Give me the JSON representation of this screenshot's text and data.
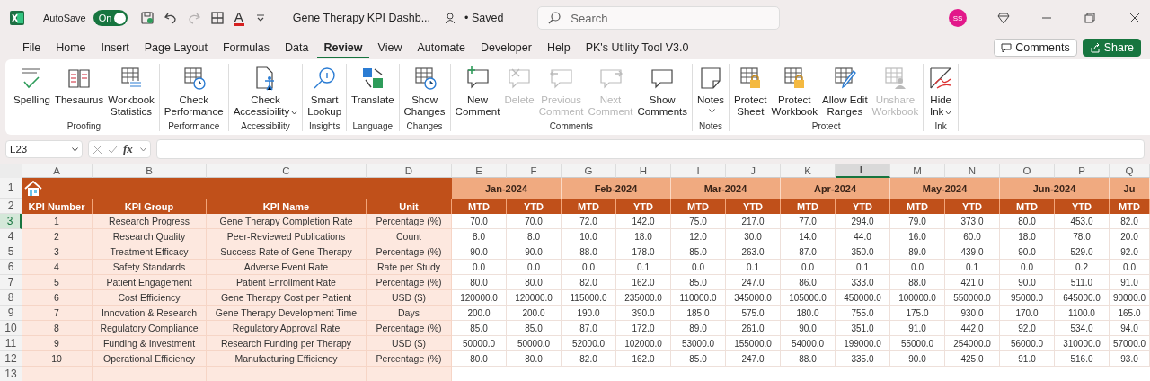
{
  "title_bar": {
    "autosave_label": "AutoSave",
    "autosave": {
      "label": "On",
      "on": true
    },
    "quick_access": [
      {
        "kind": "save",
        "disabled": false
      },
      {
        "kind": "undo",
        "disabled": false
      },
      {
        "kind": "redo",
        "disabled": true
      },
      {
        "kind": "borders",
        "disabled": false
      },
      {
        "kind": "font-color",
        "glyph": "A",
        "disabled": false
      },
      {
        "kind": "customize",
        "disabled": false
      }
    ],
    "document_title": "Gene Therapy KPI Dashb...",
    "save_status": "• Saved",
    "search_placeholder": "Search",
    "avatar_initials": "SS"
  },
  "menu_tabs": [
    {
      "label": "File",
      "selected": false
    },
    {
      "label": "Home",
      "selected": false
    },
    {
      "label": "Insert",
      "selected": false
    },
    {
      "label": "Page Layout",
      "selected": false
    },
    {
      "label": "Formulas",
      "selected": false
    },
    {
      "label": "Data",
      "selected": false
    },
    {
      "label": "Review",
      "selected": true
    },
    {
      "label": "View",
      "selected": false
    },
    {
      "label": "Automate",
      "selected": false
    },
    {
      "label": "Developer",
      "selected": false
    },
    {
      "label": "Help",
      "selected": false
    },
    {
      "label": "PK's Utility Tool V3.0",
      "selected": false
    }
  ],
  "header_buttons": [
    {
      "label": "Comments",
      "kind": "outline"
    },
    {
      "label": "Share",
      "kind": "primary"
    }
  ],
  "ribbon_groups": [
    {
      "label": "Proofing",
      "commands": [
        {
          "lines": [
            "Spelling"
          ],
          "kind": "spelling",
          "disabled": false,
          "dropdown": false
        },
        {
          "lines": [
            "Thesaurus"
          ],
          "kind": "thesaurus",
          "disabled": false,
          "dropdown": false
        },
        {
          "lines": [
            "Workbook",
            "Statistics"
          ],
          "kind": "statistics",
          "disabled": false,
          "dropdown": false
        }
      ]
    },
    {
      "label": "Performance",
      "commands": [
        {
          "lines": [
            "Check",
            "Performance"
          ],
          "kind": "performance",
          "disabled": false,
          "dropdown": false
        }
      ]
    },
    {
      "label": "Accessibility",
      "commands": [
        {
          "lines": [
            "Check",
            "Accessibility"
          ],
          "kind": "accessibility",
          "disabled": false,
          "dropdown": true
        }
      ]
    },
    {
      "label": "Insights",
      "commands": [
        {
          "lines": [
            "Smart",
            "Lookup"
          ],
          "kind": "lookup",
          "disabled": false,
          "dropdown": false
        }
      ]
    },
    {
      "label": "Language",
      "commands": [
        {
          "lines": [
            "Translate"
          ],
          "kind": "translate",
          "disabled": false,
          "dropdown": false
        }
      ]
    },
    {
      "label": "Changes",
      "commands": [
        {
          "lines": [
            "Show",
            "Changes"
          ],
          "kind": "changes",
          "disabled": false,
          "dropdown": false
        }
      ]
    },
    {
      "label": "Comments",
      "commands": [
        {
          "lines": [
            "New",
            "Comment"
          ],
          "kind": "new-comment",
          "disabled": false,
          "dropdown": false
        },
        {
          "lines": [
            "Delete"
          ],
          "kind": "delete-comment",
          "disabled": true,
          "dropdown": false
        },
        {
          "lines": [
            "Previous",
            "Comment"
          ],
          "kind": "previous-comment",
          "disabled": true,
          "dropdown": false
        },
        {
          "lines": [
            "Next",
            "Comment"
          ],
          "kind": "next-comment",
          "disabled": true,
          "dropdown": false
        },
        {
          "lines": [
            "Show",
            "Comments"
          ],
          "kind": "show-comments",
          "disabled": false,
          "dropdown": false
        }
      ]
    },
    {
      "label": "Notes",
      "commands": [
        {
          "lines": [
            "Notes"
          ],
          "kind": "notes",
          "disabled": false,
          "dropdown": true
        }
      ]
    },
    {
      "label": "Protect",
      "commands": [
        {
          "lines": [
            "Protect",
            "Sheet"
          ],
          "kind": "protect",
          "disabled": false,
          "dropdown": false
        },
        {
          "lines": [
            "Protect",
            "Workbook"
          ],
          "kind": "protect",
          "disabled": false,
          "dropdown": false
        },
        {
          "lines": [
            "Allow Edit",
            "Ranges"
          ],
          "kind": "allow-edit",
          "disabled": false,
          "dropdown": false
        },
        {
          "lines": [
            "Unshare",
            "Workbook"
          ],
          "kind": "unshare",
          "disabled": true,
          "dropdown": false
        }
      ]
    },
    {
      "label": "Ink",
      "commands": [
        {
          "lines": [
            "Hide",
            "Ink"
          ],
          "kind": "ink",
          "disabled": false,
          "dropdown": true
        }
      ]
    }
  ],
  "formula_bar": {
    "name_box": "L23",
    "function_label": "fx"
  },
  "columns": [
    {
      "letter": "A",
      "selected": false
    },
    {
      "letter": "B",
      "selected": false
    },
    {
      "letter": "C",
      "selected": false
    },
    {
      "letter": "D",
      "selected": false
    },
    {
      "letter": "E",
      "selected": false
    },
    {
      "letter": "F",
      "selected": false
    },
    {
      "letter": "G",
      "selected": false
    },
    {
      "letter": "H",
      "selected": false
    },
    {
      "letter": "I",
      "selected": false
    },
    {
      "letter": "J",
      "selected": false
    },
    {
      "letter": "K",
      "selected": false
    },
    {
      "letter": "L",
      "selected": true
    },
    {
      "letter": "M",
      "selected": false
    },
    {
      "letter": "N",
      "selected": false
    },
    {
      "letter": "O",
      "selected": false
    },
    {
      "letter": "P",
      "selected": false
    },
    {
      "letter": "Q",
      "selected": false
    }
  ],
  "row_numbers": [
    {
      "number": "1",
      "selected": false
    },
    {
      "number": "2",
      "selected": false
    },
    {
      "number": "3",
      "selected": true
    },
    {
      "number": "4",
      "selected": false
    },
    {
      "number": "5",
      "selected": false
    },
    {
      "number": "6",
      "selected": false
    },
    {
      "number": "7",
      "selected": false
    },
    {
      "number": "8",
      "selected": false
    },
    {
      "number": "9",
      "selected": false
    },
    {
      "number": "10",
      "selected": false
    },
    {
      "number": "11",
      "selected": false
    },
    {
      "number": "12",
      "selected": false
    },
    {
      "number": "13",
      "selected": false
    }
  ],
  "months": [
    "Jan-2024",
    "Feb-2024",
    "Mar-2024",
    "Apr-2024",
    "May-2024",
    "Jun-2024",
    "Ju"
  ],
  "table_headers": [
    "KPI Number",
    "KPI Group",
    "KPI Name",
    "Unit"
  ],
  "sub_headers": [
    "MTD",
    "YTD",
    "MTD",
    "YTD",
    "MTD",
    "YTD",
    "MTD",
    "YTD",
    "MTD",
    "YTD",
    "MTD",
    "YTD",
    "MTD"
  ],
  "kpis": [
    {
      "number": "1",
      "group": "Research Progress",
      "name": "Gene Therapy Completion Rate",
      "unit": "Percentage (%)",
      "values": [
        "70.0",
        "70.0",
        "72.0",
        "142.0",
        "75.0",
        "217.0",
        "77.0",
        "294.0",
        "79.0",
        "373.0",
        "80.0",
        "453.0",
        "82.0"
      ]
    },
    {
      "number": "2",
      "group": "Research Quality",
      "name": "Peer-Reviewed Publications",
      "unit": "Count",
      "values": [
        "8.0",
        "8.0",
        "10.0",
        "18.0",
        "12.0",
        "30.0",
        "14.0",
        "44.0",
        "16.0",
        "60.0",
        "18.0",
        "78.0",
        "20.0"
      ]
    },
    {
      "number": "3",
      "group": "Treatment Efficacy",
      "name": "Success Rate of Gene Therapy",
      "unit": "Percentage (%)",
      "values": [
        "90.0",
        "90.0",
        "88.0",
        "178.0",
        "85.0",
        "263.0",
        "87.0",
        "350.0",
        "89.0",
        "439.0",
        "90.0",
        "529.0",
        "92.0"
      ]
    },
    {
      "number": "4",
      "group": "Safety Standards",
      "name": "Adverse Event Rate",
      "unit": "Rate per Study",
      "values": [
        "0.0",
        "0.0",
        "0.0",
        "0.1",
        "0.0",
        "0.1",
        "0.0",
        "0.1",
        "0.0",
        "0.1",
        "0.0",
        "0.2",
        "0.0"
      ]
    },
    {
      "number": "5",
      "group": "Patient Engagement",
      "name": "Patient Enrollment Rate",
      "unit": "Percentage (%)",
      "values": [
        "80.0",
        "80.0",
        "82.0",
        "162.0",
        "85.0",
        "247.0",
        "86.0",
        "333.0",
        "88.0",
        "421.0",
        "90.0",
        "511.0",
        "91.0"
      ]
    },
    {
      "number": "6",
      "group": "Cost Efficiency",
      "name": "Gene Therapy Cost per Patient",
      "unit": "USD ($)",
      "values": [
        "120000.0",
        "120000.0",
        "115000.0",
        "235000.0",
        "110000.0",
        "345000.0",
        "105000.0",
        "450000.0",
        "100000.0",
        "550000.0",
        "95000.0",
        "645000.0",
        "90000.0"
      ]
    },
    {
      "number": "7",
      "group": "Innovation & Research",
      "name": "Gene Therapy Development Time",
      "unit": "Days",
      "values": [
        "200.0",
        "200.0",
        "190.0",
        "390.0",
        "185.0",
        "575.0",
        "180.0",
        "755.0",
        "175.0",
        "930.0",
        "170.0",
        "1100.0",
        "165.0"
      ]
    },
    {
      "number": "8",
      "group": "Regulatory Compliance",
      "name": "Regulatory Approval Rate",
      "unit": "Percentage (%)",
      "values": [
        "85.0",
        "85.0",
        "87.0",
        "172.0",
        "89.0",
        "261.0",
        "90.0",
        "351.0",
        "91.0",
        "442.0",
        "92.0",
        "534.0",
        "94.0"
      ]
    },
    {
      "number": "9",
      "group": "Funding & Investment",
      "name": "Research Funding per Therapy",
      "unit": "USD ($)",
      "values": [
        "50000.0",
        "50000.0",
        "52000.0",
        "102000.0",
        "53000.0",
        "155000.0",
        "54000.0",
        "199000.0",
        "55000.0",
        "254000.0",
        "56000.0",
        "310000.0",
        "57000.0"
      ]
    },
    {
      "number": "10",
      "group": "Operational Efficiency",
      "name": "Manufacturing Efficiency",
      "unit": "Percentage (%)",
      "values": [
        "80.0",
        "80.0",
        "82.0",
        "162.0",
        "85.0",
        "247.0",
        "88.0",
        "335.0",
        "90.0",
        "425.0",
        "91.0",
        "516.0",
        "93.0"
      ]
    }
  ]
}
